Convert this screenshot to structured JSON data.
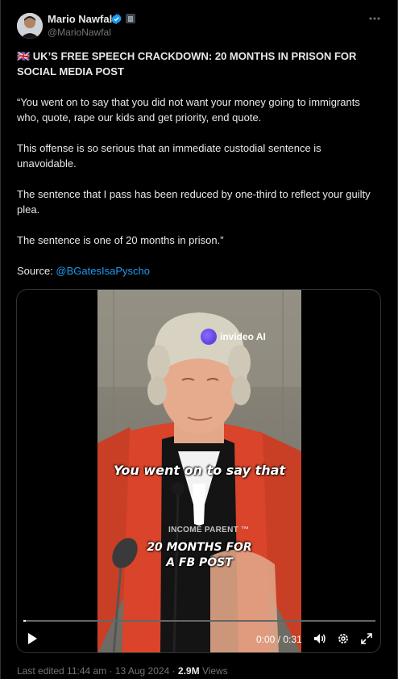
{
  "author": {
    "name": "Mario Nawfal",
    "handle": "@MarioNawfal"
  },
  "post": {
    "headline": "🇬🇧 UK’S FREE SPEECH CRACKDOWN: 20 MONTHS IN PRISON FOR SOCIAL MEDIA POST",
    "para1": "“You went on to say that you did not want your money going to immigrants who, quote, rape our kids and get priority, end quote.",
    "para2": "This offense is so serious that an immediate custodial sentence is unavoidable.",
    "para3": "The sentence that I pass has been reduced by one-third to reflect your guilty plea.",
    "para4": "The sentence is one of 20 months in prison.”",
    "source_label": "Source: ",
    "source_link": "@BGatesIsaPyscho"
  },
  "video": {
    "watermark_invideo": "invideo AI",
    "watermark_brand": "INCOME PARENT ™",
    "caption_top": "You went on to say that",
    "caption_bottom_line1": "20 MONTHS FOR",
    "caption_bottom_line2": "A FB POST",
    "time_display": "0:00 / 0:31",
    "progress": 0
  },
  "footer": {
    "edited": "Last edited 11:44 am · 13 Aug 2024 · ",
    "views_count": "2.9M",
    "views_label": " Views"
  },
  "colors": {
    "link": "#1d9bf0",
    "verified": "#1d9bf0",
    "robe": "#d9442a"
  },
  "icons": [
    "verified-badge-icon",
    "affiliate-badge-icon",
    "more-options-icon",
    "play-icon",
    "volume-icon",
    "settings-icon",
    "fullscreen-icon"
  ]
}
